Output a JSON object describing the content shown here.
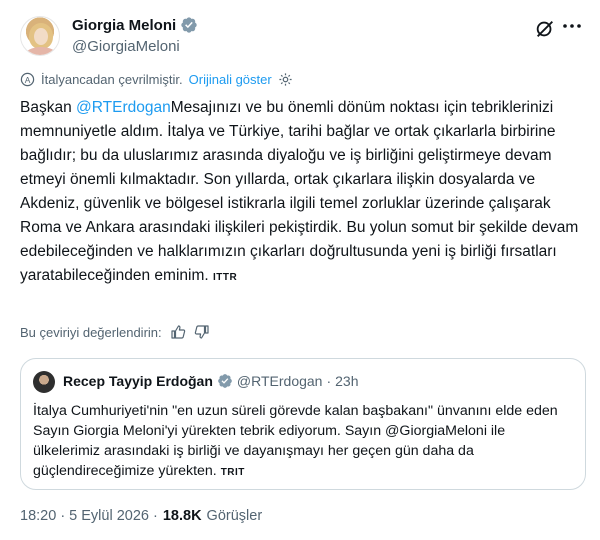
{
  "author": {
    "name": "Giorgia Meloni",
    "handle": "@GiorgiaMeloni"
  },
  "translation": {
    "translated_from": "İtalyancadan çevrilmiştir.",
    "show_original": "Orijinali göster"
  },
  "tweet": {
    "prefix": "Başkan ",
    "mention": "@RTErdogan",
    "body": "Mesajınızı ve bu önemli dönüm noktası için tebriklerinizi memnuniyetle aldım. İtalya ve Türkiye, tarihi bağlar ve ortak çıkarlarla birbirine bağlıdır; bu da uluslarımız arasında diyaloğu ve iş birliğini geliştirmeye devam etmeyi önemli kılmaktadır. Son yıllarda, ortak çıkarlara ilişkin dosyalarda ve Akdeniz, güvenlik ve bölgesel istikrarla ilgili temel zorluklar üzerinde çalışarak Roma ve Ankara arasındaki ilişkileri pekiştirdik. Bu yolun somut bir şekilde devam edebileceğinden ve halklarımızın çıkarları doğrultusunda yeni iş birliği fırsatları yaratabileceğinden eminim.",
    "tag": "ITTR"
  },
  "rating": {
    "label": "Bu çeviriyi değerlendirin:"
  },
  "quote": {
    "name": "Recep Tayyip Erdoğan",
    "handle": "@RTErdogan",
    "separator": "·",
    "time": "23h",
    "text": "İtalya Cumhuriyeti'nin \"en uzun süreli görevde kalan başbakanı\" ünvanını elde eden Sayın Giorgia Meloni'yi yürekten tebrik ediyorum. Sayın @GiorgiaMeloni ile ülkelerimiz arasındaki iş birliği ve dayanışmayı her geçen gün daha da güçlendireceğimize yürekten.",
    "tag": "TRIT"
  },
  "footer": {
    "timestamp": "18:20 · 5 Eylül 2026 ·",
    "views": "18.8K",
    "views_label": "Görüşler"
  },
  "colors": {
    "accent": "#1d9bf0",
    "text": "#0f1419",
    "secondary": "#536471",
    "border": "#cfd9de"
  },
  "icons": [
    "verified-icon",
    "grok-icon",
    "more-icon",
    "translate-icon",
    "gear-icon",
    "thumbs-up-icon",
    "thumbs-down-icon"
  ]
}
